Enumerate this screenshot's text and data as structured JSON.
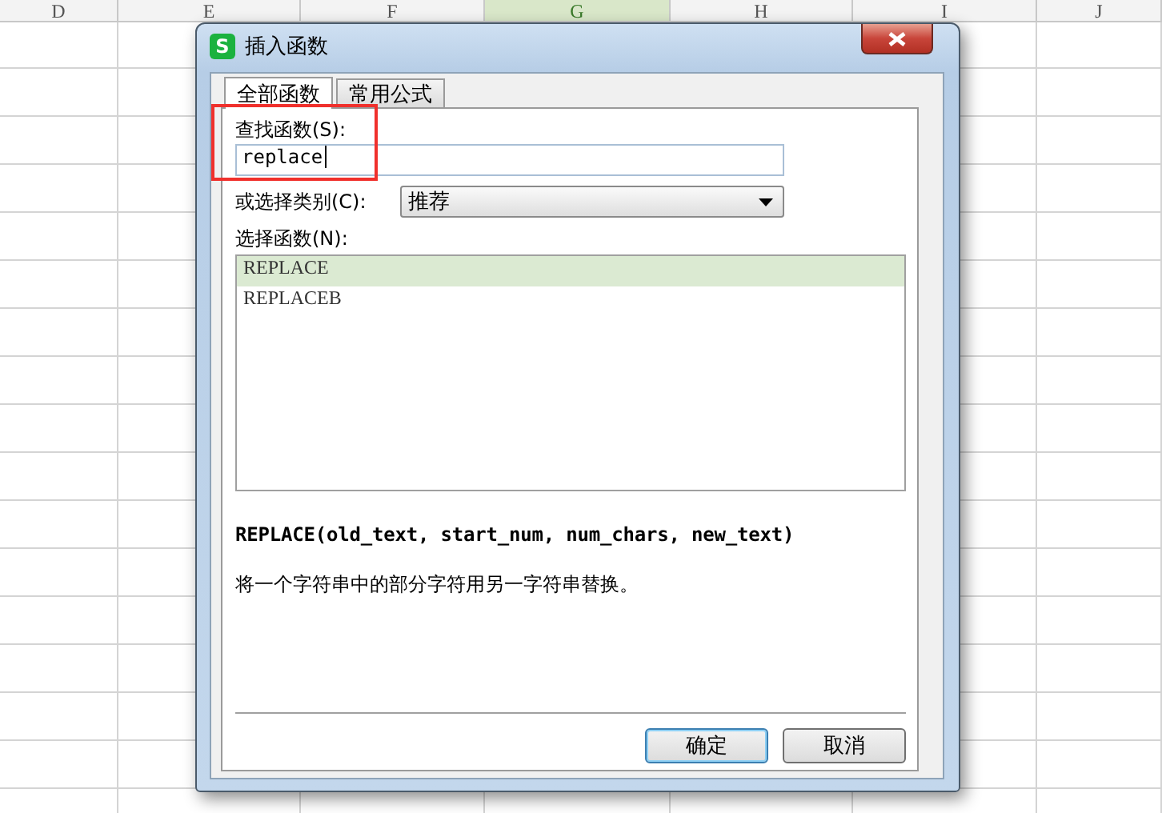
{
  "sheet": {
    "columns": [
      {
        "label": "D",
        "selected": false
      },
      {
        "label": "E",
        "selected": false
      },
      {
        "label": "F",
        "selected": false
      },
      {
        "label": "G",
        "selected": true
      },
      {
        "label": "H",
        "selected": false
      },
      {
        "label": "I",
        "selected": false
      },
      {
        "label": "J",
        "selected": false
      }
    ]
  },
  "dialog": {
    "app_icon": "S",
    "title": "插入函数",
    "tabs": [
      {
        "label": "全部函数",
        "selected": true
      },
      {
        "label": "常用公式",
        "selected": false
      }
    ],
    "search": {
      "label": "查找函数(S):",
      "value": "replace"
    },
    "category": {
      "label": "或选择类别(C):",
      "value": "推荐"
    },
    "functions": {
      "label": "选择函数(N):",
      "items": [
        {
          "name": "REPLACE",
          "selected": true
        },
        {
          "name": "REPLACEB",
          "selected": false
        }
      ]
    },
    "signature": "REPLACE(old_text, start_num, num_chars, new_text)",
    "description": "将一个字符串中的部分字符用另一字符串替换。",
    "buttons": [
      {
        "label": "确定",
        "kind": "default"
      },
      {
        "label": "取消",
        "kind": "normal"
      }
    ]
  }
}
